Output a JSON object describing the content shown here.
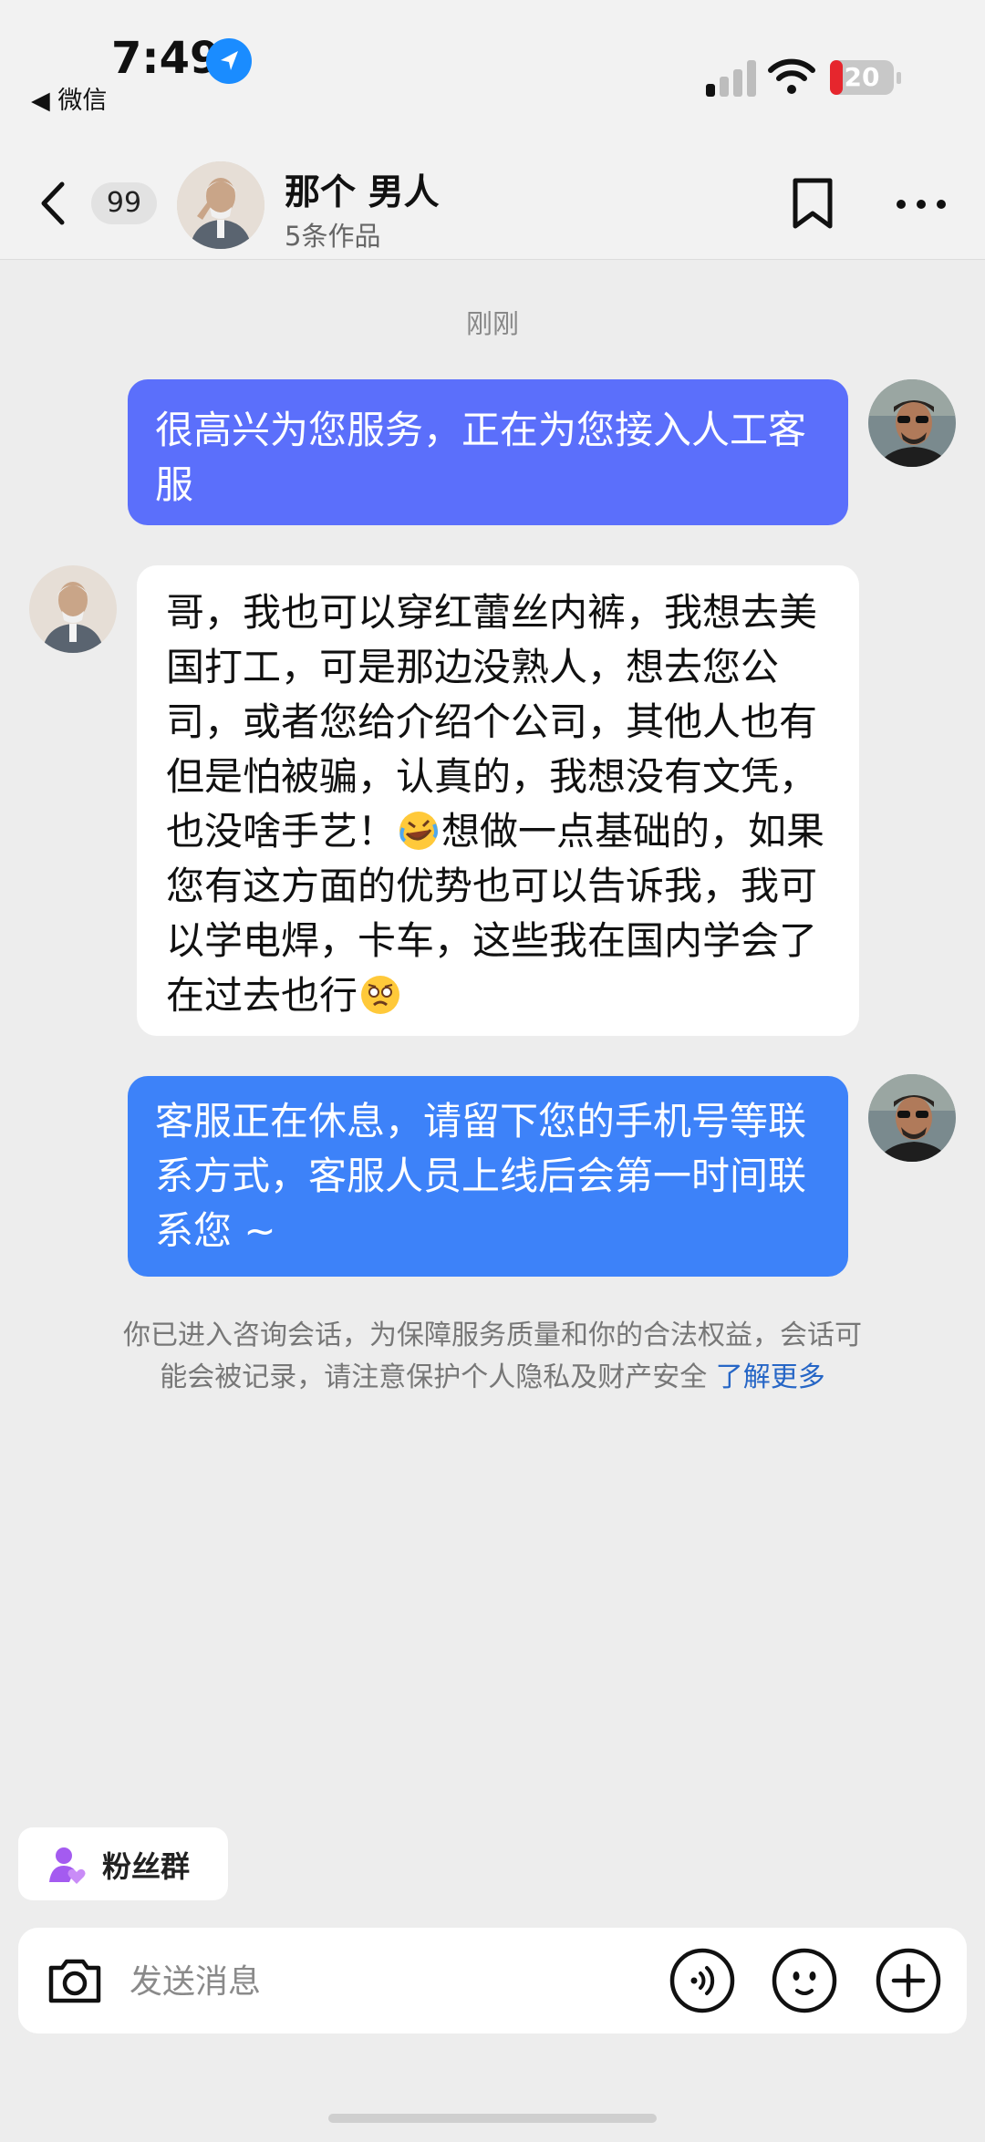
{
  "status_bar": {
    "time": "7:49",
    "back_app": "◀ 微信",
    "battery": "20",
    "battery_level": 0.2
  },
  "header": {
    "unread_count": "99",
    "name": "那个 男人",
    "subtitle": "5条作品"
  },
  "chat": {
    "timestamp": "刚刚",
    "messages": [
      {
        "from": "me",
        "text": "很高兴为您服务，正在为您接入人工客服",
        "bubble_color": "#5b6ffb"
      },
      {
        "from": "other",
        "text_a": "哥，我也可以穿红蕾丝内裤，我想去美国打工，可是那边没熟人，想去您公司，或者您给介绍个公司，其他人也有但是怕被骗，认真的，我想没有文凭，也没啥手艺！",
        "emoji_a": "rolling-on-floor-laughing",
        "text_b": "想做一点基础的，如果您有这方面的优势也可以告诉我，我可以学电焊，卡车，这些我在国内学会了在过去也行",
        "emoji_b": "holding-back-tears"
      },
      {
        "from": "me",
        "text": "客服正在休息，请留下您的手机号等联系方式，客服人员上线后会第一时间联系您 ~",
        "bubble_color": "#3d82f9"
      }
    ],
    "notice": "你已进入咨询会话，为保障服务质量和你的合法权益，会话可能会被记录，请注意保护个人隐私及财产安全",
    "notice_link": "了解更多"
  },
  "bottom": {
    "fan_group": "粉丝群",
    "input_placeholder": "发送消息"
  },
  "colors": {
    "accent_blue": "#3d82f9",
    "bubble_purple": "#5b6ffb",
    "fan_purple": "#a45bf0",
    "battery_red": "#e6262d"
  },
  "icons": [
    "location-arrow-icon",
    "signal-icon",
    "wifi-icon",
    "battery-icon",
    "back-icon",
    "bookmark-icon",
    "more-icon",
    "camera-icon",
    "voice-icon",
    "emoji-icon",
    "plus-icon",
    "fan-group-icon"
  ]
}
